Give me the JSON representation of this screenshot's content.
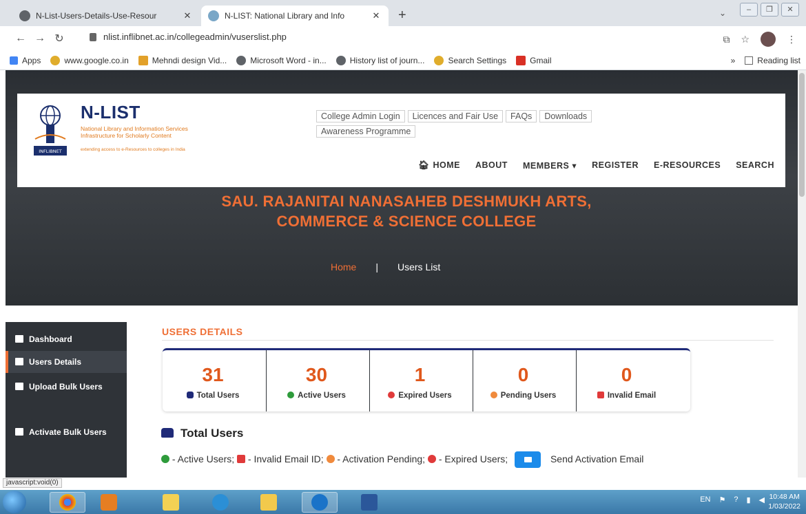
{
  "browser": {
    "tabs": [
      {
        "title": "N-List-Users-Details-Use-Resour",
        "active": false
      },
      {
        "title": "N-LIST: National Library and Info",
        "active": true
      }
    ],
    "new_tab": "+",
    "url": "nlist.inflibnet.ac.in/collegeadmin/vuserslist.php",
    "bookmarks": [
      {
        "label": "Apps"
      },
      {
        "label": "www.google.co.in"
      },
      {
        "label": "Mehndi design Vid..."
      },
      {
        "label": "Microsoft Word - in..."
      },
      {
        "label": "History list of journ..."
      },
      {
        "label": "Search Settings"
      },
      {
        "label": "Gmail"
      }
    ],
    "bookmarks_more": "»",
    "reading_list": "Reading list",
    "status_text": "javascript:void(0)"
  },
  "site": {
    "logo_title": "N-LIST",
    "logo_subtitle_1": "National Library and Information Services",
    "logo_subtitle_2": "Infrastructure for Scholarly Content",
    "logo_tagline": "extending access to e-Resources to colleges in India",
    "logo_emblem_text": "INFLIBNET",
    "top_links": [
      "College Admin Login",
      "Licences and Fair Use",
      "FAQs",
      "Downloads",
      "Awareness Programme"
    ],
    "nav": [
      "HOME",
      "ABOUT",
      "MEMBERS",
      "REGISTER",
      "E-RESOURCES",
      "SEARCH"
    ],
    "college_name": "SAU. RAJANITAI NANASAHEB DESHMUKH ARTS, COMMERCE & SCIENCE COLLEGE",
    "breadcrumb": {
      "home": "Home",
      "separator": "|",
      "current": "Users List"
    }
  },
  "sidebar": {
    "items": [
      {
        "label": "Dashboard",
        "active": false
      },
      {
        "label": "Users Details",
        "active": true
      },
      {
        "label": "Upload Bulk Users",
        "active": false
      },
      {
        "label": "Activate Bulk Users",
        "active": false
      }
    ]
  },
  "main": {
    "section_title": "USERS DETAILS",
    "stats": [
      {
        "value": "31",
        "label": "Total Users",
        "color": "#1f2a78"
      },
      {
        "value": "30",
        "label": "Active Users",
        "color": "#2e9b3b"
      },
      {
        "value": "1",
        "label": "Expired Users",
        "color": "#e03a3a"
      },
      {
        "value": "0",
        "label": "Pending Users",
        "color": "#f08a3c"
      },
      {
        "value": "0",
        "label": "Invalid Email",
        "color": "#e03a3a"
      }
    ],
    "total_users_heading": "Total Users",
    "legend": {
      "active": "- Active Users;",
      "invalid": "- Invalid Email ID;",
      "pending": "- Activation Pending;",
      "expired": "- Expired Users;",
      "send": "Send Activation Email"
    }
  },
  "taskbar": {
    "language": "EN",
    "time": "10:48 AM",
    "date": "1/03/2022"
  },
  "colors": {
    "accent": "#ef6f35",
    "brand_navy": "#1b2f6d",
    "sidebar_bg": "#2f3338",
    "button_blue": "#1b8bea"
  }
}
